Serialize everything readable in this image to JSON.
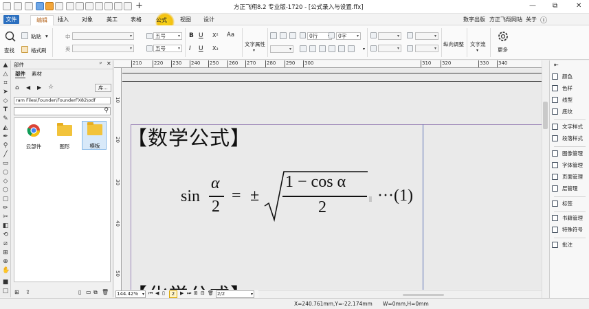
{
  "window": {
    "title": "方正飞翔8.2 专业版-1720 - [公式录入与设置.ffx]",
    "controls": [
      "—",
      "⧉",
      "✕"
    ]
  },
  "menu": {
    "items": [
      "文件",
      "编辑",
      "插入",
      "对象",
      "美工",
      "表格",
      "公式",
      "视图",
      "设计"
    ],
    "right_links": [
      "数字出版",
      "方正飞翔网站",
      "关于",
      "ⓘ"
    ]
  },
  "ribbon": {
    "find": "查找",
    "paste": "粘贴",
    "paste_dd": "▾",
    "format_brush": "格式刷",
    "font_cn_label": "中",
    "font_en_label": "英",
    "size1": "五号",
    "size2": "五号",
    "bold": "B",
    "underline": "U",
    "superscript": "X²",
    "italic": "I",
    "underline2": "U",
    "subscript": "X₂",
    "aa": "Aa",
    "text_attr": "文字属性",
    "row_value": "0行",
    "char_value": "0字",
    "vertical_adjust": "纵向调整",
    "text_flow": "文字流",
    "more": "更多"
  },
  "panel": {
    "title": "部件",
    "pin": "ᵖ",
    "close": "✕",
    "tabs": [
      "部件",
      "素材"
    ],
    "library_btn": "库...",
    "path": "ram Files\\Founder\\FounderFX82\\odf",
    "items": [
      "云部件",
      "图形",
      "模板"
    ]
  },
  "ruler": {
    "h": [
      "210",
      "220",
      "230",
      "240",
      "250",
      "260",
      "270",
      "280",
      "290",
      "300",
      "310",
      "320",
      "330",
      "340"
    ],
    "v": [
      "10",
      "20",
      "30",
      "40",
      "50"
    ]
  },
  "document": {
    "heading1": "【数学公式】",
    "heading2": "【化学公式】",
    "formula": {
      "fn": "sin",
      "alpha": "α",
      "two": "2",
      "eq": "=",
      "pm": "±",
      "num": "1 − cos α",
      "den": "2",
      "tag": "···(1)"
    }
  },
  "navigation": {
    "zoom": "144.42%",
    "page_current": "2",
    "page_total": "2/2"
  },
  "status": {
    "coords": "X=240.761mm,Y=-22.174mm",
    "size": "W=0mm,H=0mm"
  },
  "right_panel": {
    "items": [
      "颜色",
      "色样",
      "线型",
      "底纹",
      "文字样式",
      "段落样式",
      "图像管理",
      "字体管理",
      "页面管理",
      "层管理",
      "标签",
      "书籍管理",
      "特殊符号",
      "批注"
    ]
  }
}
